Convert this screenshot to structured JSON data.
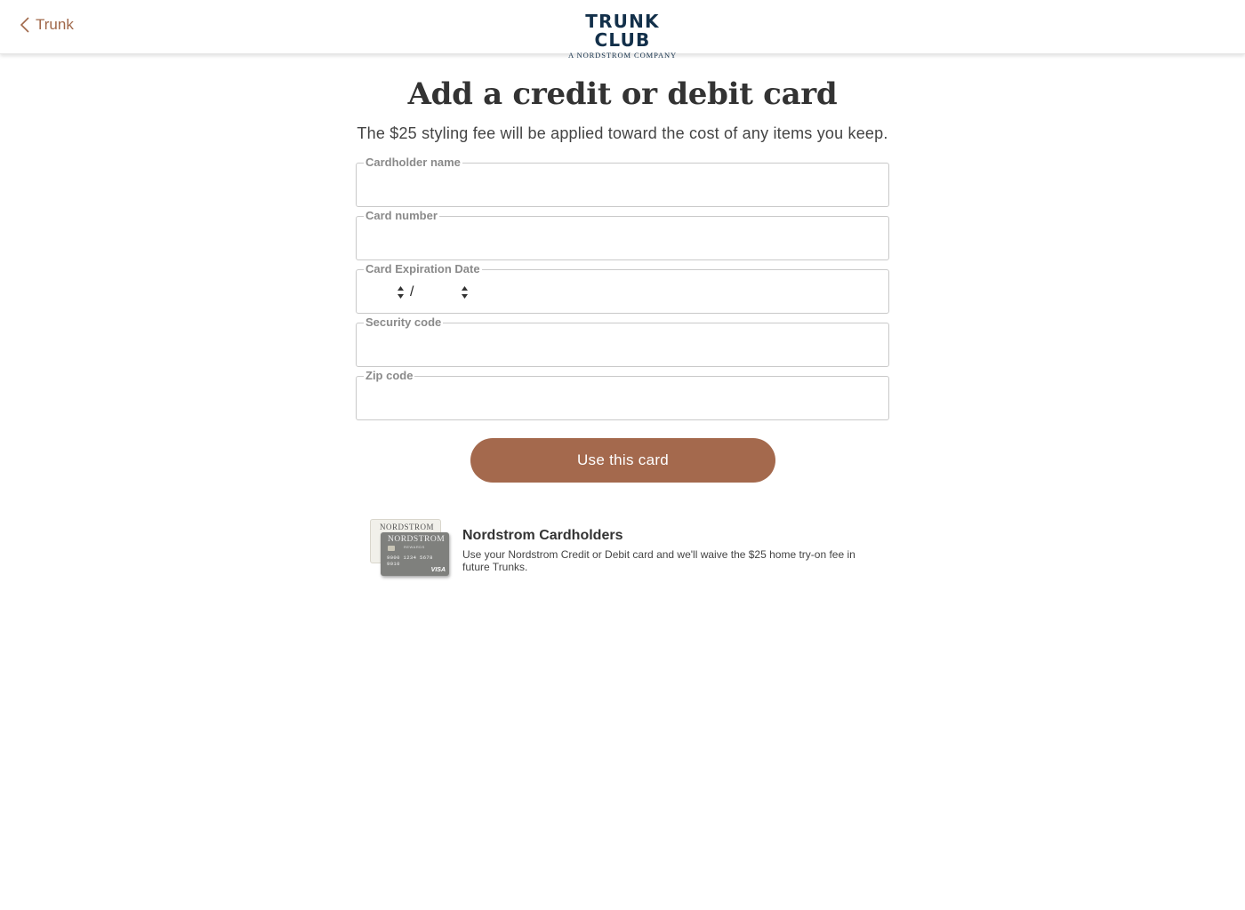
{
  "header": {
    "back_label": "Trunk",
    "logo_main": "TRUNK CLUB",
    "logo_sub": "A NORDSTROM COMPANY"
  },
  "page": {
    "title": "Add a credit or debit card",
    "subtitle": "The $25 styling fee will be applied toward the cost of any items you keep."
  },
  "form": {
    "cardholder_label": "Cardholder name",
    "cardholder_value": "",
    "card_number_label": "Card number",
    "card_number_value": "",
    "expiration_label": "Card Expiration Date",
    "exp_month_value": "",
    "exp_separator": "/",
    "exp_year_value": "",
    "security_label": "Security code",
    "security_value": "",
    "zip_label": "Zip code",
    "zip_value": "",
    "submit_label": "Use this card"
  },
  "promo": {
    "title": "Nordstrom Cardholders",
    "text": "Use your Nordstrom Credit or Debit card and we'll waive the $25 home try-on fee in future Trunks.",
    "card_back_brand": "NORDSTROM",
    "card_front_brand": "NORDSTROM",
    "card_front_sub": "REWARDS",
    "card_number": "9000 1234 5678 9010",
    "card_network": "VISA"
  },
  "colors": {
    "accent": "#a4694d",
    "link": "#a0684a",
    "logo": "#13304a",
    "label": "#8a8a8a"
  }
}
